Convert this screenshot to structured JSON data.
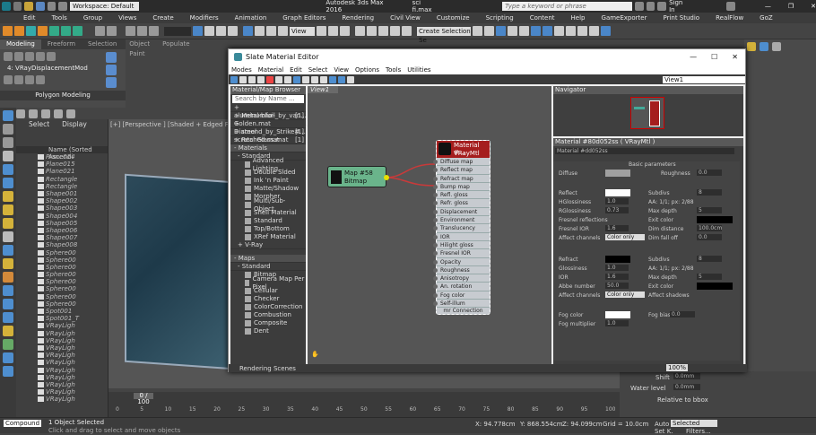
{
  "app": {
    "workspace": "Workspace: Default",
    "title": "Autodesk 3ds Max 2016",
    "file": "sci fi.max",
    "search_placeholder": "Type a keyword or phrase",
    "sign_in": "Sign In"
  },
  "menu": [
    "Edit",
    "Tools",
    "Group",
    "Views",
    "Create",
    "Modifiers",
    "Animation",
    "Graph Editors",
    "Rendering",
    "Civil View",
    "Customize",
    "Scripting",
    "Content",
    "Help",
    "GameExporter",
    "Print Studio",
    "RealFlow",
    "GoZ"
  ],
  "toolbar": {
    "view_dropdown": "View",
    "selection_set": "Create Selection Se"
  },
  "ribbon": {
    "tabs": [
      "Modeling",
      "Freeform",
      "Selection",
      "Object Paint",
      "Populate"
    ],
    "modifier": "4: VRayDisplacementMod",
    "panel": "Polygon Modeling"
  },
  "scene": {
    "tabs": [
      "Select",
      "Display"
    ],
    "header": "Name (Sorted Ascendi",
    "items": [
      "Plane014",
      "Plane015",
      "Plane021",
      "Rectangle",
      "Rectangle",
      "Shape001",
      "Shape002",
      "Shape003",
      "Shape004",
      "Shape005",
      "Shape006",
      "Shape007",
      "Shape008",
      "Sphere00",
      "Sphere00",
      "Sphere00",
      "Sphere00",
      "Sphere00",
      "Sphere00",
      "Sphere00",
      "Sphere00",
      "Spot001",
      "Spot001_T",
      "VRayLigh",
      "VRayLigh",
      "VRayLigh",
      "VRayLigh",
      "VRayLigh",
      "VRayLigh",
      "VRayLigh",
      "VRayLigh",
      "VRayLigh",
      "VRayLigh",
      "VRayLigh"
    ]
  },
  "viewport": {
    "label": "[+] [Perspective ] [Shaded + Edged Faces ]"
  },
  "slate": {
    "title": "Slate Material Editor",
    "menu": [
      "Modes",
      "Material",
      "Edit",
      "Select",
      "View",
      "Options",
      "Tools",
      "Utilities"
    ],
    "browser_header": "Material/Map Browser",
    "browser_search": "Search by Name ...",
    "libraries": [
      "+ aluminumfoil_by_van...",
      "+ Metal-blur-Golden.mat",
      "+ Diamond_by_Strike#...",
      "+ steel scratched.mat",
      "+ Real Glass.mat"
    ],
    "lib_counts": [
      "[1]",
      "[1]",
      "[1]",
      "[1]",
      "[1]"
    ],
    "materials_header": "- Materials",
    "standard_header": "- Standard",
    "materials": [
      "Advanced Lighting...",
      "Double Sided",
      "Ink 'n Paint",
      "Matte/Shadow",
      "Morpher",
      "Multi/Sub-Object",
      "Shell Material",
      "Standard",
      "Top/Bottom",
      "XRef Material"
    ],
    "vray_header": "+ V-Ray",
    "maps_header": "- Maps",
    "maps_standard": "- Standard",
    "maps": [
      "Bitmap",
      "Camera Map Per Pixel",
      "Cellular",
      "Checker",
      "ColorCorrection",
      "Combustion",
      "Composite",
      "Dent"
    ],
    "view_tab": "View1",
    "view_dropdown": "View1",
    "rendering_scenes": "Rendering Scenes",
    "zoom": "100%",
    "map_node": {
      "name": "Map #58",
      "type": "Bitmap"
    },
    "mat_node": {
      "name": "Material #...",
      "type": "VRayMtl"
    },
    "slots": [
      "Diffuse map",
      "Reflect map",
      "Refract map",
      "Bump map",
      "Refl. gloss",
      "Refr. gloss",
      "Displacement",
      "Environment",
      "Translucency",
      "IOR",
      "Hilight gloss",
      "Fresnel IOR",
      "Opacity",
      "Roughness",
      "Anisotropy",
      "An. rotation",
      "Fog color",
      "Self-illum"
    ],
    "mr_connection": "mr Connection",
    "navigator": "Navigator",
    "param_title": "Material #80d052ss  ( VRayMtl )",
    "param_name": "Material #dd052ss",
    "basic_params": "Basic parameters",
    "labels": {
      "diffuse": "Diffuse",
      "roughness": "Roughness",
      "roughness_val": "0.0",
      "reflect": "Reflect",
      "subdivs": "Subdivs",
      "subdivs_val": "8",
      "hgloss": "HGlossiness",
      "hgloss_val": "1.0",
      "aa": "AA: 1/1; px: 2/88",
      "rgloss": "RGlossiness",
      "rgloss_val": "0.73",
      "maxdepth": "Max depth",
      "maxdepth_val": "5",
      "fresnel": "Fresnel reflections",
      "exit": "Exit color",
      "fresnel_ior": "Fresnel IOR",
      "fresnel_ior_val": "1.6",
      "dim_dist": "Dim distance",
      "dim_dist_val": "100.0cm",
      "affect": "Affect channels",
      "affect_val": "Color only",
      "dim_falloff": "Dim fall off",
      "dim_falloff_val": "0.0",
      "refract": "Refract",
      "refr_subdivs_val": "8",
      "glossiness": "Glossiness",
      "glossiness_val": "1.0",
      "aa2": "AA: 1/1; px: 2/88",
      "ior": "IOR",
      "ior_val": "1.6",
      "maxdepth2_val": "5",
      "abbe": "Abbe number",
      "abbe_val": "50.0",
      "exit2": "Exit color",
      "affect2_val": "Color only",
      "affect_shadows": "Affect shadows",
      "fog_color": "Fog color",
      "fog_bias": "Fog bias",
      "fog_bias_val": "0.0",
      "fog_mult": "Fog multiplier",
      "fog_mult_val": "1.0"
    }
  },
  "timeline": {
    "frame": "0 / 100",
    "ticks": [
      "0",
      "5",
      "10",
      "15",
      "20",
      "25",
      "30",
      "35",
      "40",
      "45",
      "50",
      "55",
      "60",
      "65",
      "70",
      "75",
      "80",
      "85",
      "90",
      "95",
      "100"
    ]
  },
  "status": {
    "selected": "1 Object Selected",
    "hint": "Click and drag to select and move objects",
    "compound": "Compound",
    "x": "X: 94.778cm",
    "y": "Y: 868.554cm",
    "z": "Z: 94.099cm",
    "grid": "Grid = 10.0cm",
    "auto": "Auto",
    "selected_dd": "Selected",
    "setk": "Set K.",
    "filters": "Filters..."
  },
  "right_panel": {
    "shift": "Shift",
    "shift_val": "0.0mm",
    "water_level": "Water level",
    "water_val": "0.0mm",
    "relative": "Relative to bbox"
  }
}
